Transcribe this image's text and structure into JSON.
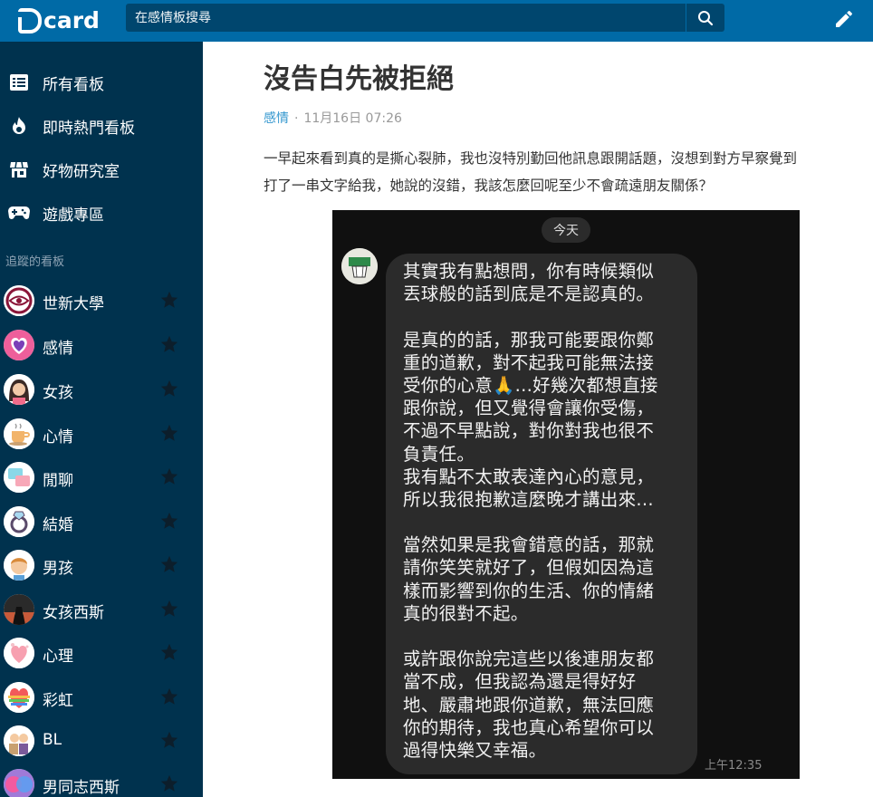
{
  "header": {
    "logo_text": "card",
    "search_placeholder": "在感情板搜尋"
  },
  "sidebar": {
    "nav": [
      {
        "label": "所有看板",
        "icon": "list-icon"
      },
      {
        "label": "即時熱門看板",
        "icon": "flame-icon"
      },
      {
        "label": "好物研究室",
        "icon": "store-icon"
      },
      {
        "label": "遊戲專區",
        "icon": "gamepad-icon"
      }
    ],
    "followed_title": "追蹤的看板",
    "boards": [
      {
        "label": "世新大學"
      },
      {
        "label": "感情"
      },
      {
        "label": "女孩"
      },
      {
        "label": "心情"
      },
      {
        "label": "閒聊"
      },
      {
        "label": "結婚"
      },
      {
        "label": "男孩"
      },
      {
        "label": "女孩西斯"
      },
      {
        "label": "心理"
      },
      {
        "label": "彩虹"
      },
      {
        "label": "BL"
      },
      {
        "label": "男同志西斯"
      }
    ]
  },
  "post": {
    "title": "沒告白先被拒絕",
    "board": "感情",
    "separator": "·",
    "date": "11月16日 07:26",
    "body_lines": [
      "一早起來看到真的是撕心裂肺，我也沒特別勤回他訊息跟開話題，沒想到對方早察覺到",
      "打了一串文字給我，她說的沒錯，我該怎麼回呢至少不會疏遠朋友關係？"
    ]
  },
  "screenshot": {
    "day_label": "今天",
    "time": "上午12:35",
    "message_lines": [
      "其實我有點想問，你有時候類似",
      "丟球般的話到底是不是認真的。",
      "",
      "是真的的話，那我可能要跟你鄭",
      "重的道歉，對不起我可能無法接",
      "受你的心意🙏...好幾次都想直接",
      "跟你說，但又覺得會讓你受傷，",
      "不過不早點說，對你對我也很不",
      "負責任。",
      "我有點不太敢表達內心的意見，",
      "所以我很抱歉這麼晚才講出來...",
      "",
      "當然如果是我會錯意的話，那就",
      "請你笑笑就好了，但假如因為這",
      "樣而影響到你的生活、你的情緒",
      "真的很對不起。",
      "",
      "或許跟你說完這些以後連朋友都",
      "當不成，但我認為還是得好好",
      "地、嚴肅地跟你道歉，無法回應",
      "你的期待，我也真心希望你可以",
      "過得快樂又幸福。"
    ]
  },
  "colors": {
    "header": "#006aa6",
    "search_bg": "#00466e",
    "sidebar": "#00324e",
    "link": "#3397cf"
  }
}
